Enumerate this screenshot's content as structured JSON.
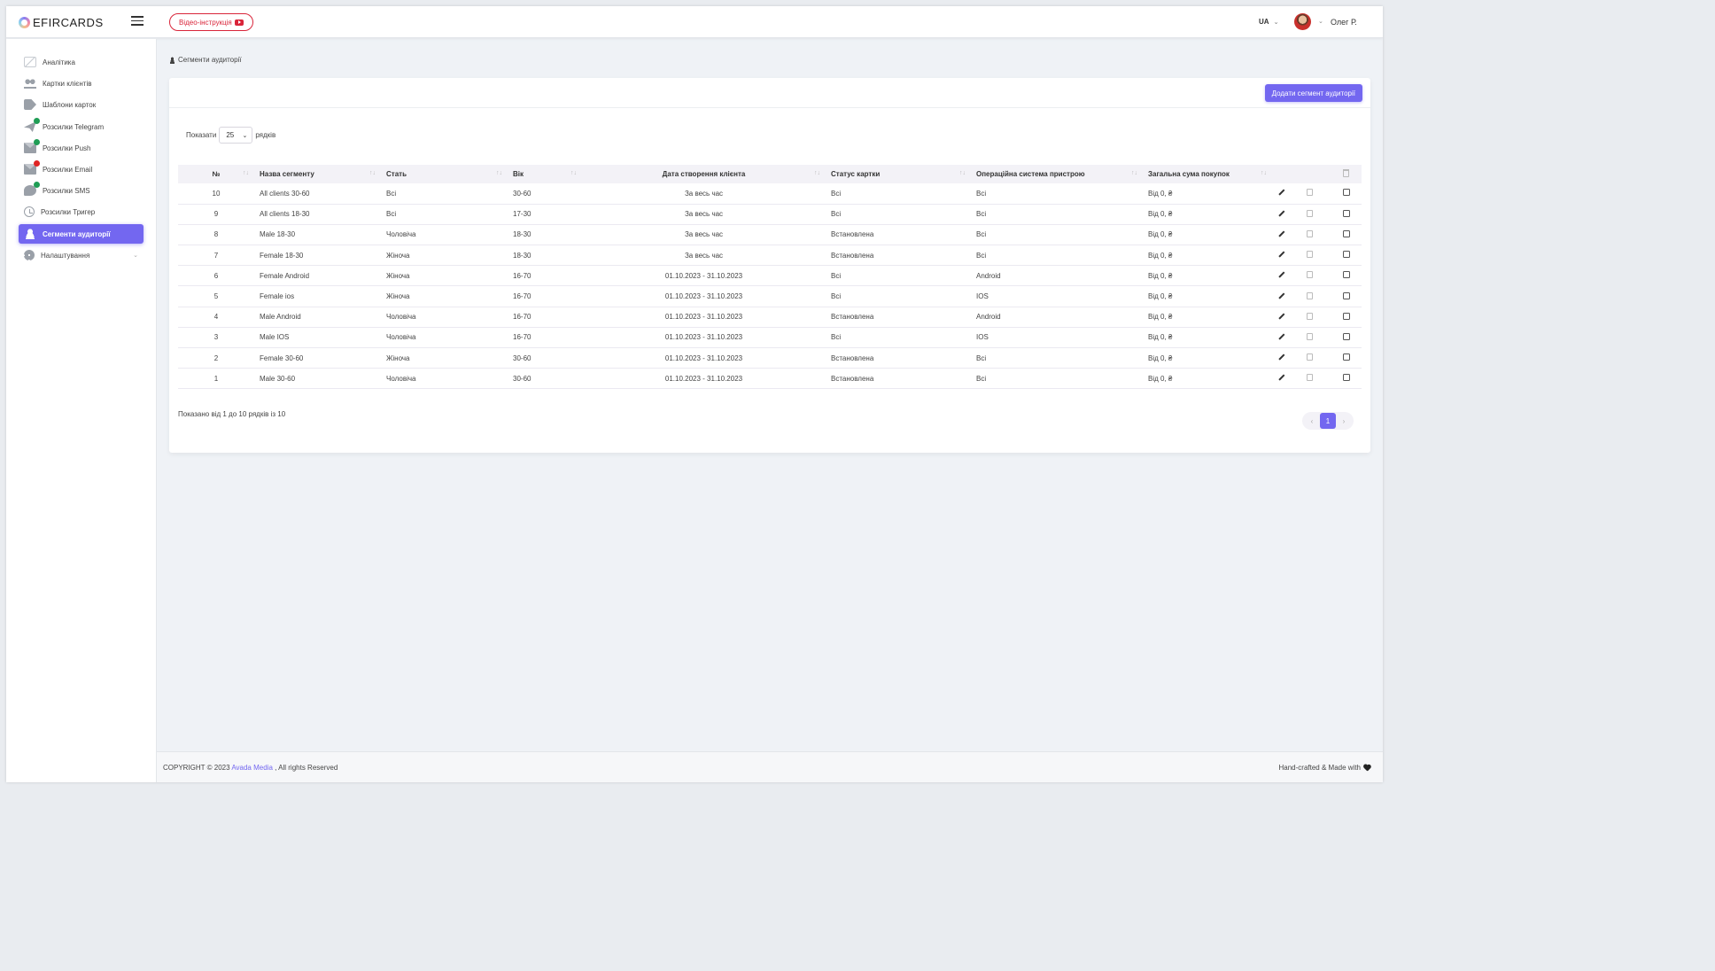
{
  "header": {
    "logo_text": "EFIRCARDS",
    "video_label": "Відео-інструкція",
    "lang": "UA",
    "user_name": "Олег Р."
  },
  "sidebar": {
    "items": [
      {
        "label": "Аналітика",
        "icon": "chart-icon"
      },
      {
        "label": "Картки клієнтів",
        "icon": "users-icon"
      },
      {
        "label": "Шаблони карток",
        "icon": "tag-icon"
      },
      {
        "label": "Розсилки Telegram",
        "icon": "send-icon",
        "status": "green"
      },
      {
        "label": "Розсилки Push",
        "icon": "mail-icon",
        "status": "green"
      },
      {
        "label": "Розсилки Email",
        "icon": "mail-icon",
        "status": "red"
      },
      {
        "label": "Розсилки SMS",
        "icon": "chat-icon",
        "status": "green"
      },
      {
        "label": "Розсилки Тригер",
        "icon": "clock-icon"
      },
      {
        "label": "Сегменти аудиторії",
        "icon": "person-icon",
        "active": true
      },
      {
        "label": "Налаштування",
        "icon": "gear-icon"
      }
    ]
  },
  "breadcrumb": "Сегменти аудиторії",
  "toolbar": {
    "add_label": "Додати сегмент аудиторії",
    "show_label": "Показати",
    "rows_value": "25",
    "rows_suffix": "рядків"
  },
  "table": {
    "columns": [
      "№",
      "Назва сегменту",
      "Стать",
      "Вік",
      "Дата створення клієнта",
      "Статус картки",
      "Операційна система пристрою",
      "Загальна сума покупок"
    ],
    "rows": [
      [
        "10",
        "All clients 30-60",
        "Всі",
        "30-60",
        "За весь час",
        "Всі",
        "Всі",
        "Від 0, ₴"
      ],
      [
        "9",
        "All clients 18-30",
        "Всі",
        "17-30",
        "За весь час",
        "Всі",
        "Всі",
        "Від 0, ₴"
      ],
      [
        "8",
        "Male 18-30",
        "Чоловіча",
        "18-30",
        "За весь час",
        "Встановлена",
        "Всі",
        "Від 0, ₴"
      ],
      [
        "7",
        "Female 18-30",
        "Жіноча",
        "18-30",
        "За весь час",
        "Встановлена",
        "Всі",
        "Від 0, ₴"
      ],
      [
        "6",
        "Female Android",
        "Жіноча",
        "16-70",
        "01.10.2023 - 31.10.2023",
        "Всі",
        "Android",
        "Від 0, ₴"
      ],
      [
        "5",
        "Female ios",
        "Жіноча",
        "16-70",
        "01.10.2023 - 31.10.2023",
        "Всі",
        "IOS",
        "Від 0, ₴"
      ],
      [
        "4",
        "Male Android",
        "Чоловіча",
        "16-70",
        "01.10.2023 - 31.10.2023",
        "Встановлена",
        "Android",
        "Від 0, ₴"
      ],
      [
        "3",
        "Male IOS",
        "Чоловіча",
        "16-70",
        "01.10.2023 - 31.10.2023",
        "Всі",
        "IOS",
        "Від 0, ₴"
      ],
      [
        "2",
        "Female 30-60",
        "Жіноча",
        "30-60",
        "01.10.2023 - 31.10.2023",
        "Встановлена",
        "Всі",
        "Від 0, ₴"
      ],
      [
        "1",
        "Male 30-60",
        "Чоловіча",
        "30-60",
        "01.10.2023 - 31.10.2023",
        "Встановлена",
        "Всі",
        "Від 0, ₴"
      ]
    ],
    "info": "Показано від 1 до 10 рядків із 10"
  },
  "pagination": {
    "prev": "‹",
    "current": "1",
    "next": "›"
  },
  "footer": {
    "copyright_prefix": "COPYRIGHT © 2023",
    "company": "Avada Media",
    "copyright_suffix": ", All rights Reserved",
    "handcrafted": "Hand-crafted & Made with"
  },
  "colors": {
    "accent": "#7367f0",
    "video_red": "#d9253a",
    "status_green": "#1f9d55",
    "status_red": "#e02424"
  }
}
